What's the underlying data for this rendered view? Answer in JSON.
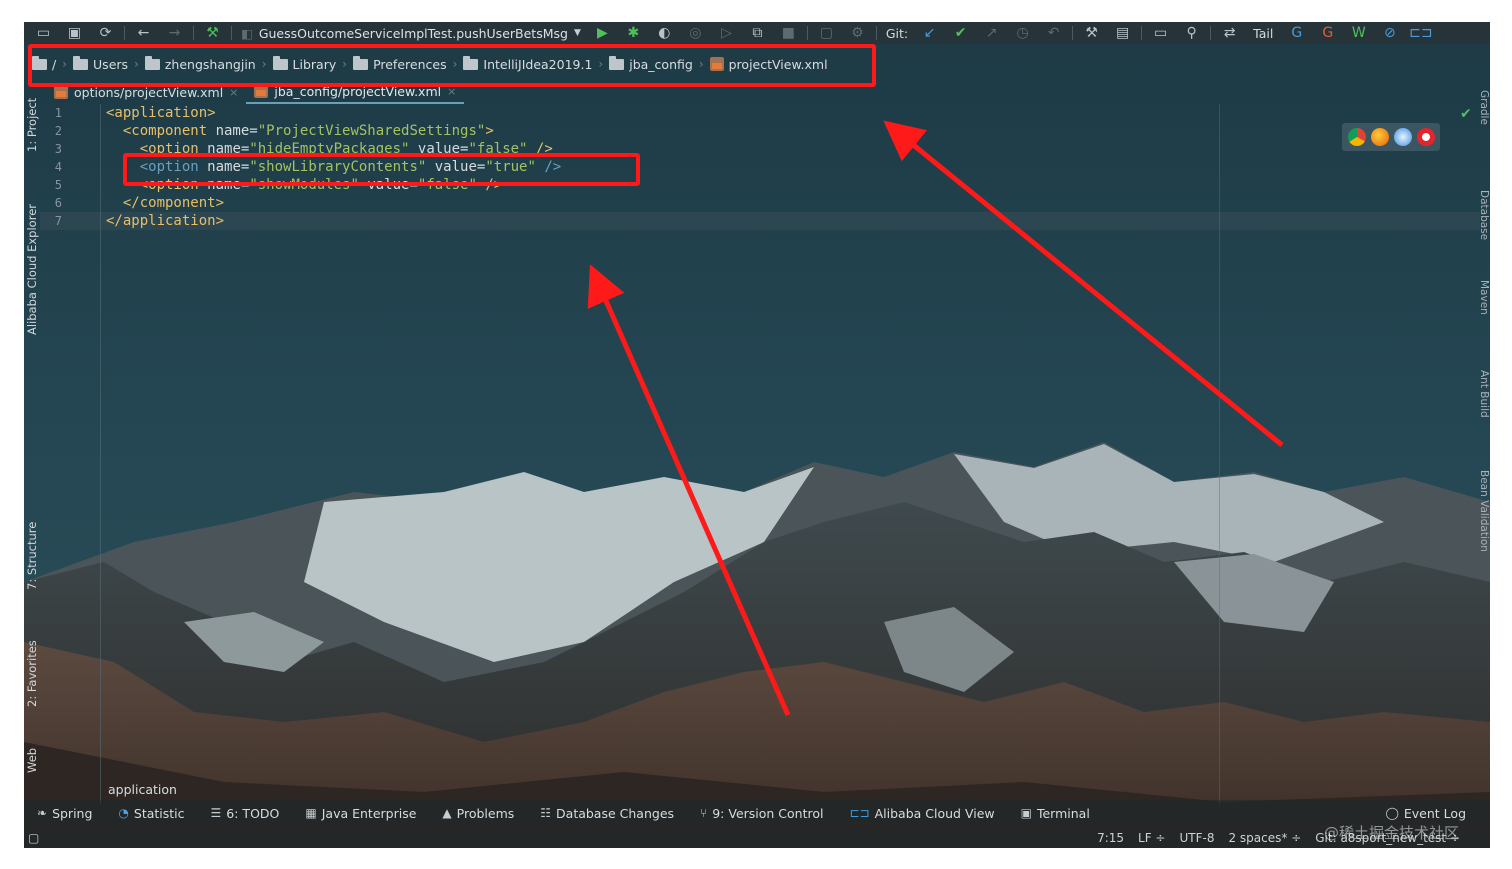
{
  "toolbar": {
    "run_config": "GuessOutcomeServiceImplTest.pushUserBetsMsg",
    "git_label": "Git:",
    "tail_label": "Tail",
    "icons": [
      "open-folder-icon",
      "save-icon",
      "sync-icon",
      "back-icon",
      "forward-icon",
      "build-icon",
      "run-icon",
      "debug-icon",
      "coverage-icon",
      "profile-icon",
      "run-dim-icon",
      "attach-icon",
      "stop-icon",
      "layout-icon",
      "sdk-icon",
      "git-update-icon",
      "git-commit-icon",
      "git-push-icon",
      "history-icon",
      "revert-icon",
      "wrench-icon",
      "project-structure-icon",
      "frame-icon",
      "search-icon",
      "translate-icon"
    ]
  },
  "breadcrumb": {
    "items": [
      "/",
      "Users",
      "zhengshangjin",
      "Library",
      "Preferences",
      "IntelliJIdea2019.1",
      "jba_config",
      "projectView.xml"
    ]
  },
  "tabs": [
    {
      "label": "options/projectView.xml",
      "active": false
    },
    {
      "label": "jba_config/projectView.xml",
      "active": true
    }
  ],
  "left_tools": {
    "project": "1: Project",
    "alibaba": "Alibaba Cloud Explorer",
    "structure": "7: Structure",
    "favorites": "2: Favorites",
    "web": "Web"
  },
  "right_tools": [
    "Gradle",
    "Database",
    "Maven",
    "Ant Build",
    "Bean Validation"
  ],
  "editor": {
    "lines": [
      {
        "num": "1",
        "parts": [
          {
            "t": "<application>",
            "c": "tag"
          }
        ]
      },
      {
        "num": "2",
        "parts": [
          {
            "t": "  <component ",
            "c": "tag"
          },
          {
            "t": "name=",
            "c": "attr"
          },
          {
            "t": "\"ProjectViewSharedSettings\"",
            "c": "val"
          },
          {
            "t": ">",
            "c": "tag"
          }
        ]
      },
      {
        "num": "3",
        "parts": [
          {
            "t": "    <option ",
            "c": "tag"
          },
          {
            "t": "name=",
            "c": "attr"
          },
          {
            "t": "\"hideEmptyPackages\"",
            "c": "val"
          },
          {
            "t": " value=",
            "c": "attr"
          },
          {
            "t": "\"false\"",
            "c": "val"
          },
          {
            "t": " />",
            "c": "tag"
          }
        ]
      },
      {
        "num": "4",
        "parts": [
          {
            "t": "    <option ",
            "c": "tagd"
          },
          {
            "t": "name=",
            "c": "attr"
          },
          {
            "t": "\"showLibraryContents\"",
            "c": "val"
          },
          {
            "t": " value=",
            "c": "attr"
          },
          {
            "t": "\"true\"",
            "c": "val"
          },
          {
            "t": " />",
            "c": "tagd"
          }
        ]
      },
      {
        "num": "5",
        "parts": [
          {
            "t": "    <option ",
            "c": "tag"
          },
          {
            "t": "name=",
            "c": "attr"
          },
          {
            "t": "\"showModules\"",
            "c": "val"
          },
          {
            "t": " value=",
            "c": "attr"
          },
          {
            "t": "\"false\"",
            "c": "val"
          },
          {
            "t": " />",
            "c": "tag"
          }
        ]
      },
      {
        "num": "6",
        "parts": [
          {
            "t": "  </component>",
            "c": "tag"
          }
        ]
      },
      {
        "num": "7",
        "parts": [
          {
            "t": "</application>",
            "c": "tag"
          }
        ]
      }
    ],
    "footer_crumb": "application"
  },
  "tool_windows": [
    {
      "label": "Spring",
      "icon": "spring-icon"
    },
    {
      "label": "Statistic",
      "icon": "statistic-icon"
    },
    {
      "label": "6: TODO",
      "icon": "todo-icon"
    },
    {
      "label": "Java Enterprise",
      "icon": "java-enterprise-icon"
    },
    {
      "label": "Problems",
      "icon": "warning-icon"
    },
    {
      "label": "Database Changes",
      "icon": "database-icon"
    },
    {
      "label": "9: Version Control",
      "icon": "vcs-icon"
    },
    {
      "label": "Alibaba Cloud View",
      "icon": "alibaba-cloud-icon"
    },
    {
      "label": "Terminal",
      "icon": "terminal-icon"
    }
  ],
  "event_log": "Event Log",
  "status": {
    "position": "7:15",
    "line_sep": "LF ÷",
    "encoding": "UTF-8",
    "indent": "2 spaces* ÷",
    "git": "Git: a8sport_new_test ÷"
  },
  "watermark": "@稀土掘金技术社区",
  "colors": {
    "annotation_red": "#ff1a1a",
    "ide_bg": "#1f3d48",
    "xml_tag": "#e8bf6a",
    "xml_value": "#a5c261"
  }
}
